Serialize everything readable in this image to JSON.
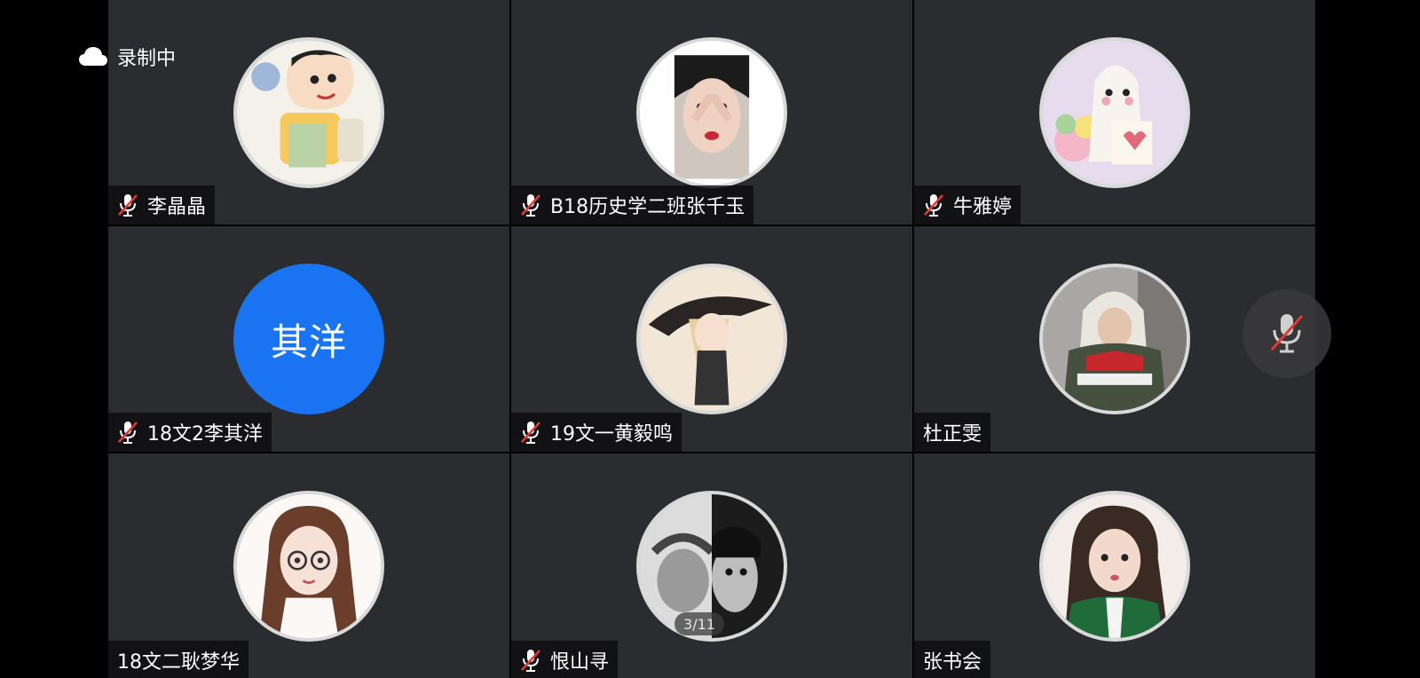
{
  "recording": {
    "label": "录制中",
    "icon": "cloud-icon"
  },
  "participants": [
    {
      "name": "李晶晶",
      "muted": true,
      "avatar": "cartoon-boy-photo"
    },
    {
      "name": "B18历史学二班张千玉",
      "muted": true,
      "avatar": "girl-selfie-photo"
    },
    {
      "name": "牛雅婷",
      "muted": true,
      "avatar": "ghost-flowers-photo"
    },
    {
      "name": "18文2李其洋",
      "muted": true,
      "avatar_text": "其洋",
      "avatar_color": "#1a73f0"
    },
    {
      "name": "19文一黄毅鸣",
      "muted": true,
      "avatar": "anime-witch-photo"
    },
    {
      "name": "杜正雯",
      "muted": false,
      "avatar": "hooded-person-photo"
    },
    {
      "name": "18文二耿梦华",
      "muted": false,
      "avatar": "cartoon-girl-glasses-photo"
    },
    {
      "name": "恨山寻",
      "muted": true,
      "avatar": "bw-portrait-photo"
    },
    {
      "name": "张书会",
      "muted": false,
      "avatar": "girl-green-jacket-photo"
    }
  ],
  "pagination": {
    "label": "3/11"
  },
  "self_mic": {
    "state": "muted",
    "icon": "mic-muted-icon"
  },
  "colors": {
    "tile_background": "#2b2c2f",
    "text_avatar": "#1a73f0",
    "mute_slash": "#e53935"
  }
}
